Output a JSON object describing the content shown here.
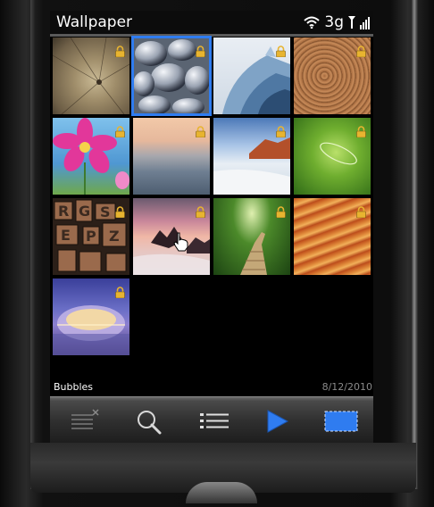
{
  "header": {
    "title": "Wallpaper",
    "network": "3g",
    "icons": [
      "wifi-icon",
      "battery-icon",
      "signal-bars-icon"
    ]
  },
  "gallery": {
    "thumbnails": [
      {
        "subject": "compass-sepia",
        "locked": true,
        "selected": false
      },
      {
        "subject": "bubbles",
        "locked": true,
        "selected": true
      },
      {
        "subject": "modern-architecture",
        "locked": true,
        "selected": false
      },
      {
        "subject": "wood-spiral",
        "locked": true,
        "selected": false
      },
      {
        "subject": "pink-flower",
        "locked": true,
        "selected": false
      },
      {
        "subject": "calm-sea",
        "locked": true,
        "selected": false
      },
      {
        "subject": "coastal-rocks",
        "locked": true,
        "selected": false
      },
      {
        "subject": "green-drop",
        "locked": true,
        "selected": false
      },
      {
        "subject": "letterpress-type",
        "locked": true,
        "selected": false
      },
      {
        "subject": "beach-sunset",
        "locked": true,
        "selected": false
      },
      {
        "subject": "forest-path",
        "locked": true,
        "selected": false
      },
      {
        "subject": "sandstone-waves",
        "locked": true,
        "selected": false
      },
      {
        "subject": "glass-dome",
        "locked": true,
        "selected": false
      }
    ]
  },
  "footer": {
    "selected_name": "Bubbles",
    "date": "8/12/2010"
  },
  "toolbar": {
    "items": [
      "delete-list-icon",
      "search-icon",
      "list-view-icon",
      "play-icon",
      "fullscreen-icon"
    ]
  },
  "colors": {
    "selection": "#2f7cf0",
    "toolbar_play": "#2f7cf0",
    "lock": "#e8b430"
  }
}
